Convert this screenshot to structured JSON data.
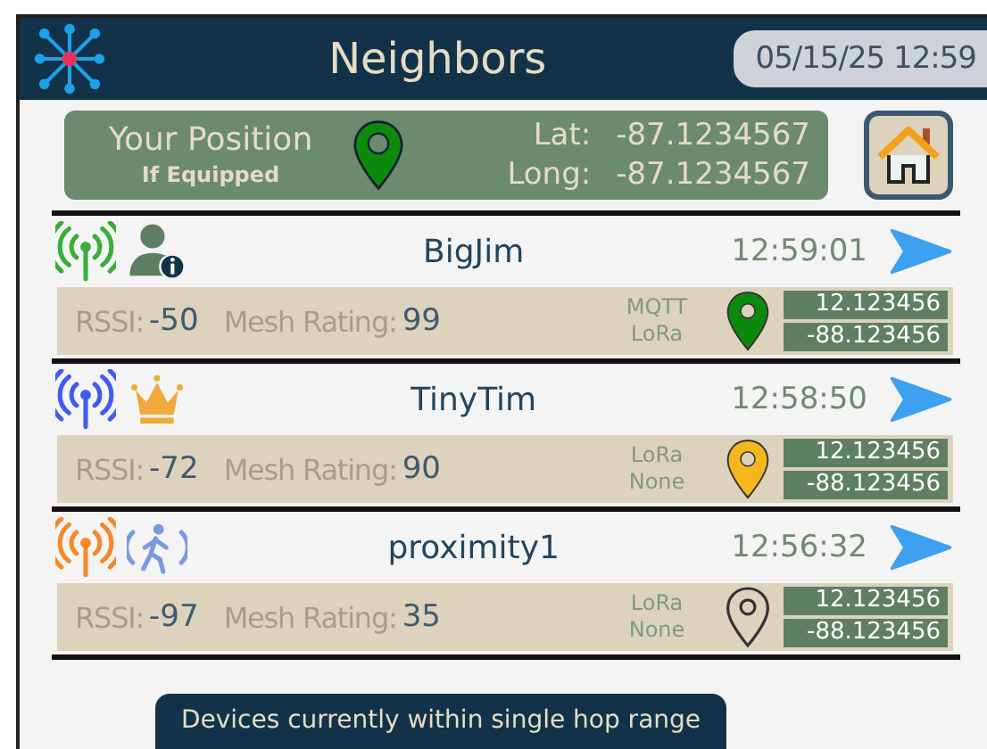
{
  "header": {
    "title": "Neighbors",
    "datetime": "05/15/25 12:59"
  },
  "position": {
    "title": "Your Position",
    "subtitle": "If Equipped",
    "lat_label": "Lat:",
    "lat": "-87.1234567",
    "long_label": "Long:",
    "long": "-87.1234567"
  },
  "neighbors": [
    {
      "color": "#3aad3a",
      "badge": {
        "kind": "person-info"
      },
      "name": "BigJim",
      "time": "12:59:01",
      "rssi_label": "RSSI:",
      "rssi": "-50",
      "rating_label": "Mesh Rating:",
      "rating": "99",
      "transports": [
        "MQTT",
        "LoRa"
      ],
      "pin": {
        "kind": "filled",
        "color": "#0c8a0c"
      },
      "lat": "12.123456",
      "lon": "-88.123456"
    },
    {
      "color": "#3f5cf0",
      "badge": {
        "kind": "crown"
      },
      "name": "TinyTim",
      "time": "12:58:50",
      "rssi_label": "RSSI:",
      "rssi": "-72",
      "rating_label": "Mesh Rating:",
      "rating": "90",
      "transports": [
        "LoRa",
        "None"
      ],
      "pin": {
        "kind": "filled",
        "color": "#f5b71c"
      },
      "lat": "12.123456",
      "lon": "-88.123456"
    },
    {
      "color": "#f5892a",
      "badge": {
        "kind": "walker"
      },
      "name": "proximity1",
      "time": "12:56:32",
      "rssi_label": "RSSI:",
      "rssi": "-97",
      "rating_label": "Mesh Rating:",
      "rating": "35",
      "transports": [
        "LoRa",
        "None"
      ],
      "pin": {
        "kind": "outline"
      },
      "lat": "12.123456",
      "lon": "-88.123456"
    }
  ],
  "footer": {
    "caption": "Devices currently within single hop range"
  }
}
